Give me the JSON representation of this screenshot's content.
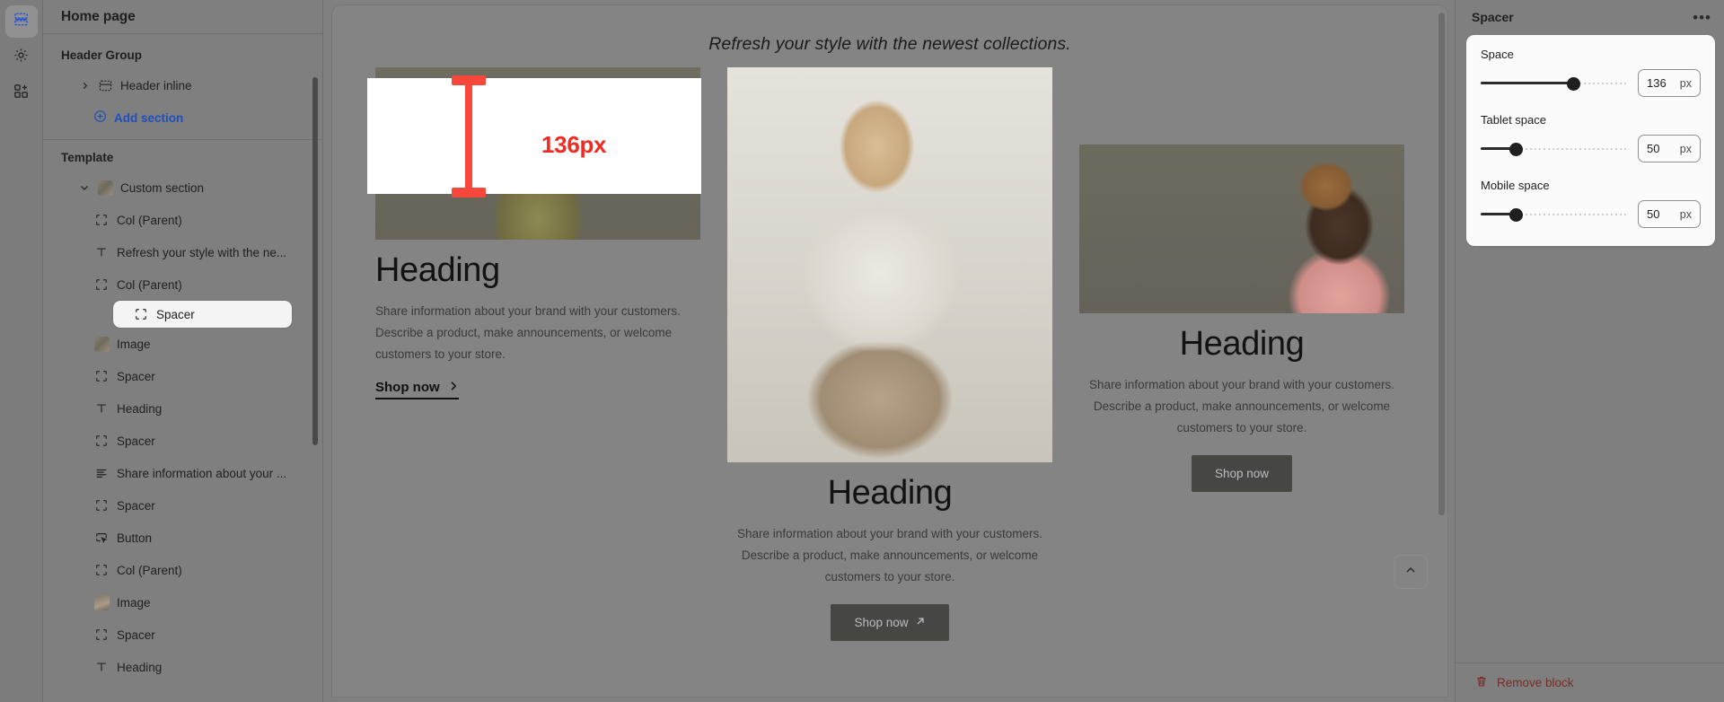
{
  "rail": {
    "items": [
      {
        "icon": "sections-icon",
        "name": "sections",
        "active": true
      },
      {
        "icon": "gear-icon",
        "name": "settings",
        "active": false
      },
      {
        "icon": "add-blocks-icon",
        "name": "add-blocks",
        "active": false
      }
    ]
  },
  "sidebar": {
    "title": "Home page",
    "header_group": {
      "label": "Header Group",
      "items": [
        {
          "label": "Header inline",
          "icon": "header-inline-icon",
          "expandable": true
        }
      ],
      "add_section_label": "Add section"
    },
    "template": {
      "label": "Template",
      "items": [
        {
          "label": "Custom section",
          "icon": "image-thumb-icon",
          "depth": 0,
          "expanded": true
        },
        {
          "label": "Col (Parent)",
          "icon": "frame-icon",
          "depth": 1
        },
        {
          "label": "Refresh your style with the ne...",
          "icon": "text-icon",
          "depth": 1
        },
        {
          "label": "Col (Parent)",
          "icon": "frame-icon",
          "depth": 1
        },
        {
          "label": "Spacer",
          "icon": "frame-icon",
          "depth": 1,
          "selected": true
        },
        {
          "label": "Image",
          "icon": "image-thumb-icon",
          "depth": 1
        },
        {
          "label": "Spacer",
          "icon": "frame-icon",
          "depth": 1
        },
        {
          "label": "Heading",
          "icon": "text-icon",
          "depth": 1
        },
        {
          "label": "Spacer",
          "icon": "frame-icon",
          "depth": 1
        },
        {
          "label": "Share information about your ...",
          "icon": "paragraph-icon",
          "depth": 1
        },
        {
          "label": "Spacer",
          "icon": "frame-icon",
          "depth": 1
        },
        {
          "label": "Button",
          "icon": "button-icon",
          "depth": 1
        },
        {
          "label": "Col (Parent)",
          "icon": "frame-icon",
          "depth": 1
        },
        {
          "label": "Image",
          "icon": "image-thumb-icon",
          "depth": 1
        },
        {
          "label": "Spacer",
          "icon": "frame-icon",
          "depth": 1
        },
        {
          "label": "Heading",
          "icon": "text-icon",
          "depth": 1
        }
      ]
    }
  },
  "canvas": {
    "headline": "Refresh your style with the newest collections.",
    "spacer_overlay": {
      "size_label": "136px",
      "color": "#f02b22"
    },
    "columns": [
      {
        "heading": "Heading",
        "body": "Share information about your brand with your customers. Describe a product, make announcements, or welcome customers to your store.",
        "cta_label": "Shop now",
        "cta_style": "link",
        "cta_icon": "chevron-right-icon"
      },
      {
        "heading": "Heading",
        "body": "Share information about your brand with your customers. Describe a product, make announcements, or welcome customers to your store.",
        "cta_label": "Shop now",
        "cta_style": "button",
        "cta_icon": "arrow-up-right-icon"
      },
      {
        "heading": "Heading",
        "body": "Share information about your brand with your customers. Describe a product, make announcements, or welcome customers to your store.",
        "cta_label": "Shop now",
        "cta_style": "button",
        "cta_icon": ""
      }
    ],
    "scroll_top_icon": "chevron-up-icon"
  },
  "right_panel": {
    "title": "Spacer",
    "more_label": "•••",
    "fields": [
      {
        "label": "Space",
        "value": "136",
        "unit": "px",
        "fill_pct": 63
      },
      {
        "label": "Tablet space",
        "value": "50",
        "unit": "px",
        "fill_pct": 24
      },
      {
        "label": "Mobile space",
        "value": "50",
        "unit": "px",
        "fill_pct": 24
      }
    ],
    "remove_label": "Remove block",
    "remove_icon": "trash-icon",
    "remove_color": "#7a2c28"
  }
}
